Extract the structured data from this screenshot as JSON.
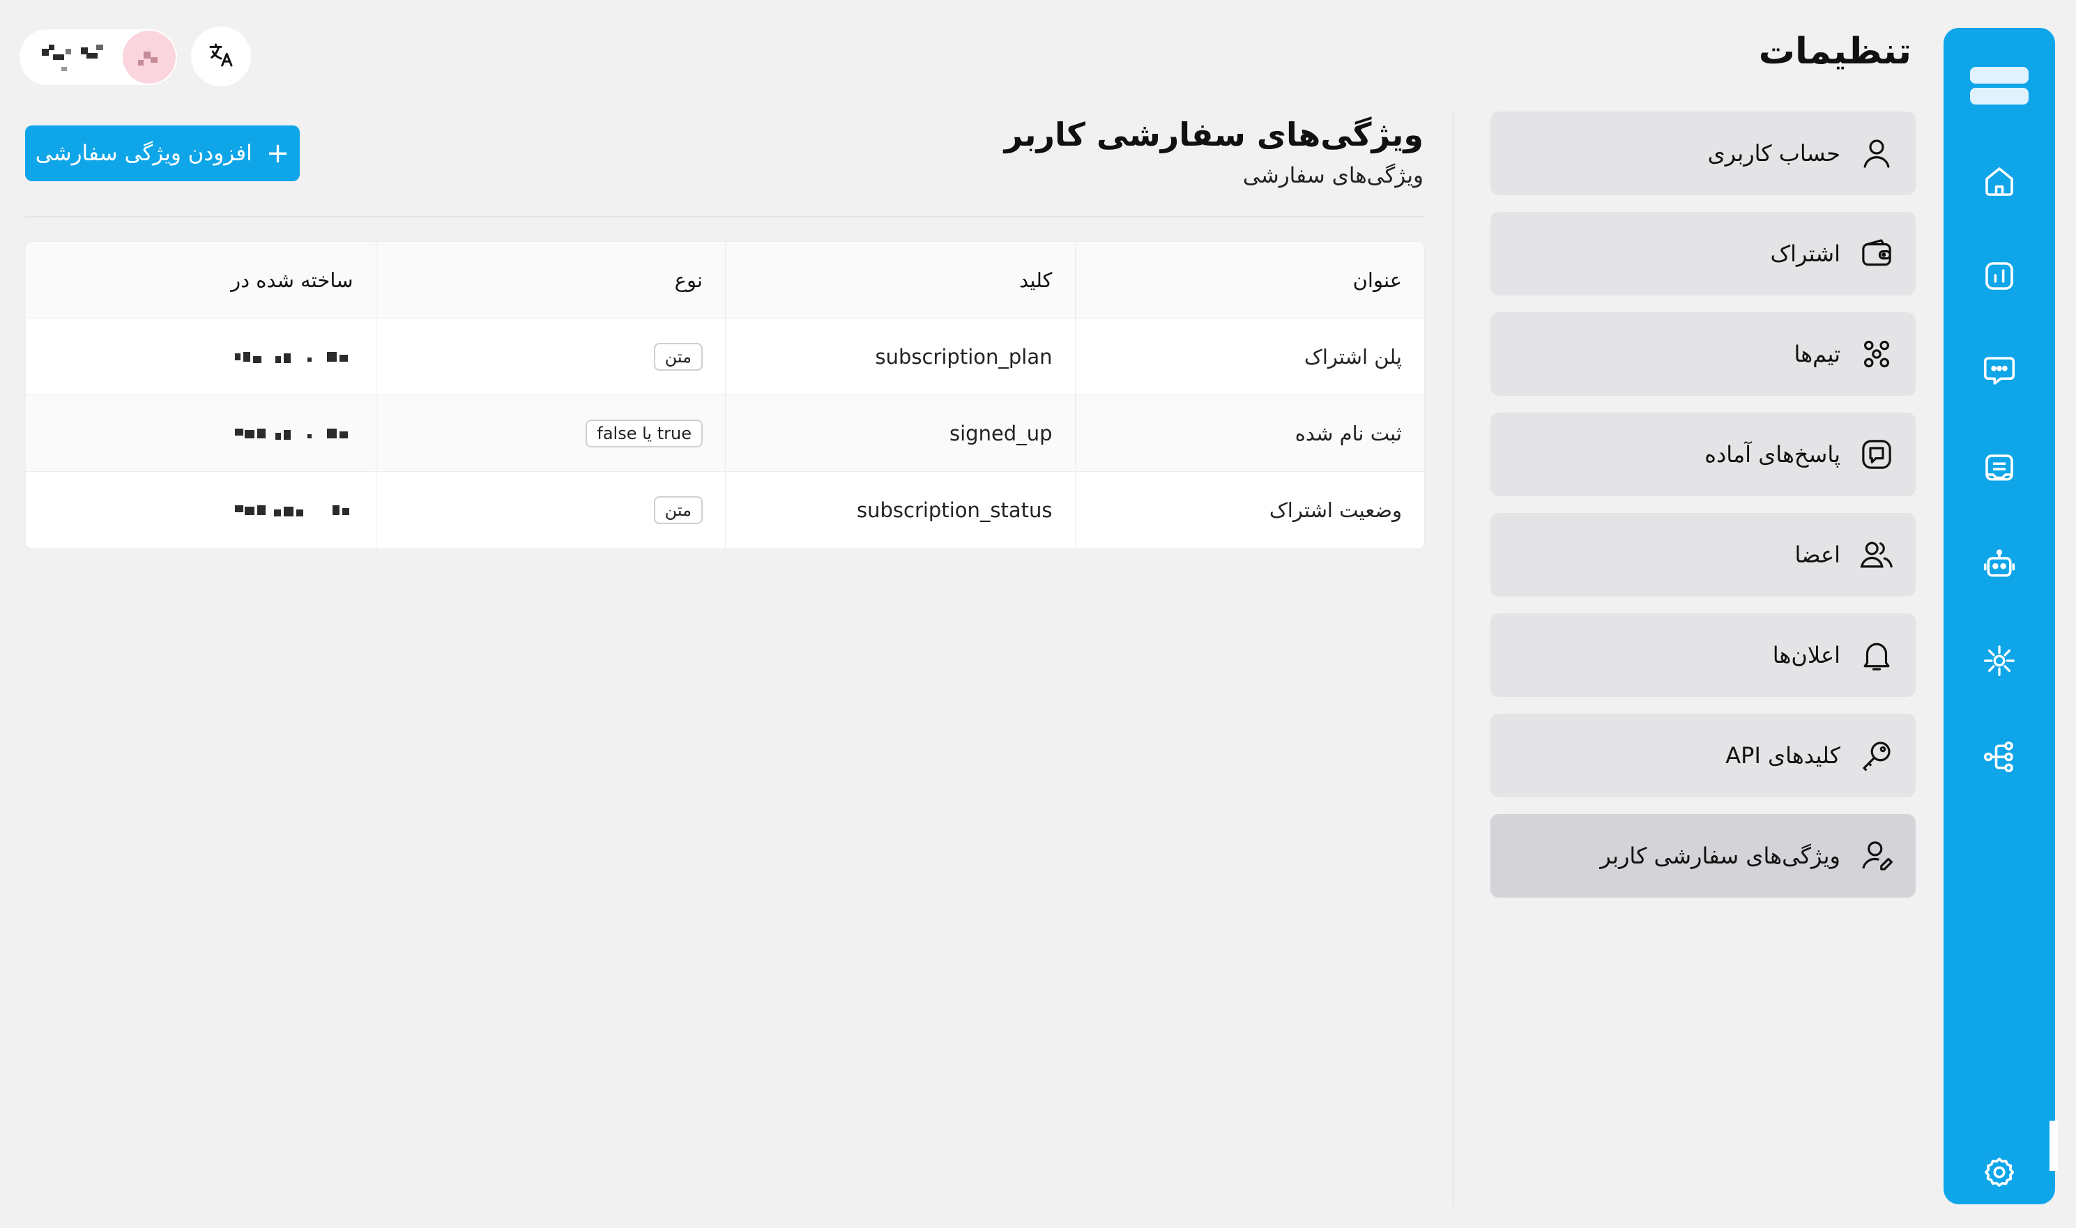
{
  "page": {
    "title": "تنظیمات"
  },
  "header": {
    "translate_icon": "translate-icon"
  },
  "menu": {
    "items": [
      {
        "label": "حساب کاربری",
        "icon": "user-icon"
      },
      {
        "label": "اشتراک",
        "icon": "wallet-icon"
      },
      {
        "label": "تیم‌ها",
        "icon": "team-icon"
      },
      {
        "label": "پاسخ‌های آماده",
        "icon": "canned-response-icon"
      },
      {
        "label": "اعضا",
        "icon": "members-icon"
      },
      {
        "label": "اعلان‌ها",
        "icon": "bell-icon"
      },
      {
        "label": "کلیدهای API",
        "icon": "key-icon"
      },
      {
        "label": "ویژگی‌های سفارشی کاربر",
        "icon": "user-edit-icon",
        "active": true
      }
    ]
  },
  "rail": {
    "icons": [
      "home-icon",
      "analytics-icon",
      "chat-icon",
      "inbox-icon",
      "bot-icon",
      "integration-icon",
      "flow-icon",
      "settings-icon"
    ],
    "accent": "#0ea5e9"
  },
  "content": {
    "title": "ویژگی‌های سفارشی کاربر",
    "subtitle": "ویژگی‌های سفارشی",
    "add_button": {
      "plus": "+",
      "label": "افزودن ویژگی سفارشی"
    }
  },
  "table": {
    "columns": [
      "عنوان",
      "کلید",
      "نوع",
      "ساخته شده در"
    ],
    "rows": [
      {
        "title": "پلن اشتراک",
        "key": "subscription_plan",
        "type": "متن"
      },
      {
        "title": "ثبت نام شده",
        "key": "signed_up",
        "type": "true یا false"
      },
      {
        "title": "وضعیت اشتراک",
        "key": "subscription_status",
        "type": "متن"
      }
    ]
  }
}
